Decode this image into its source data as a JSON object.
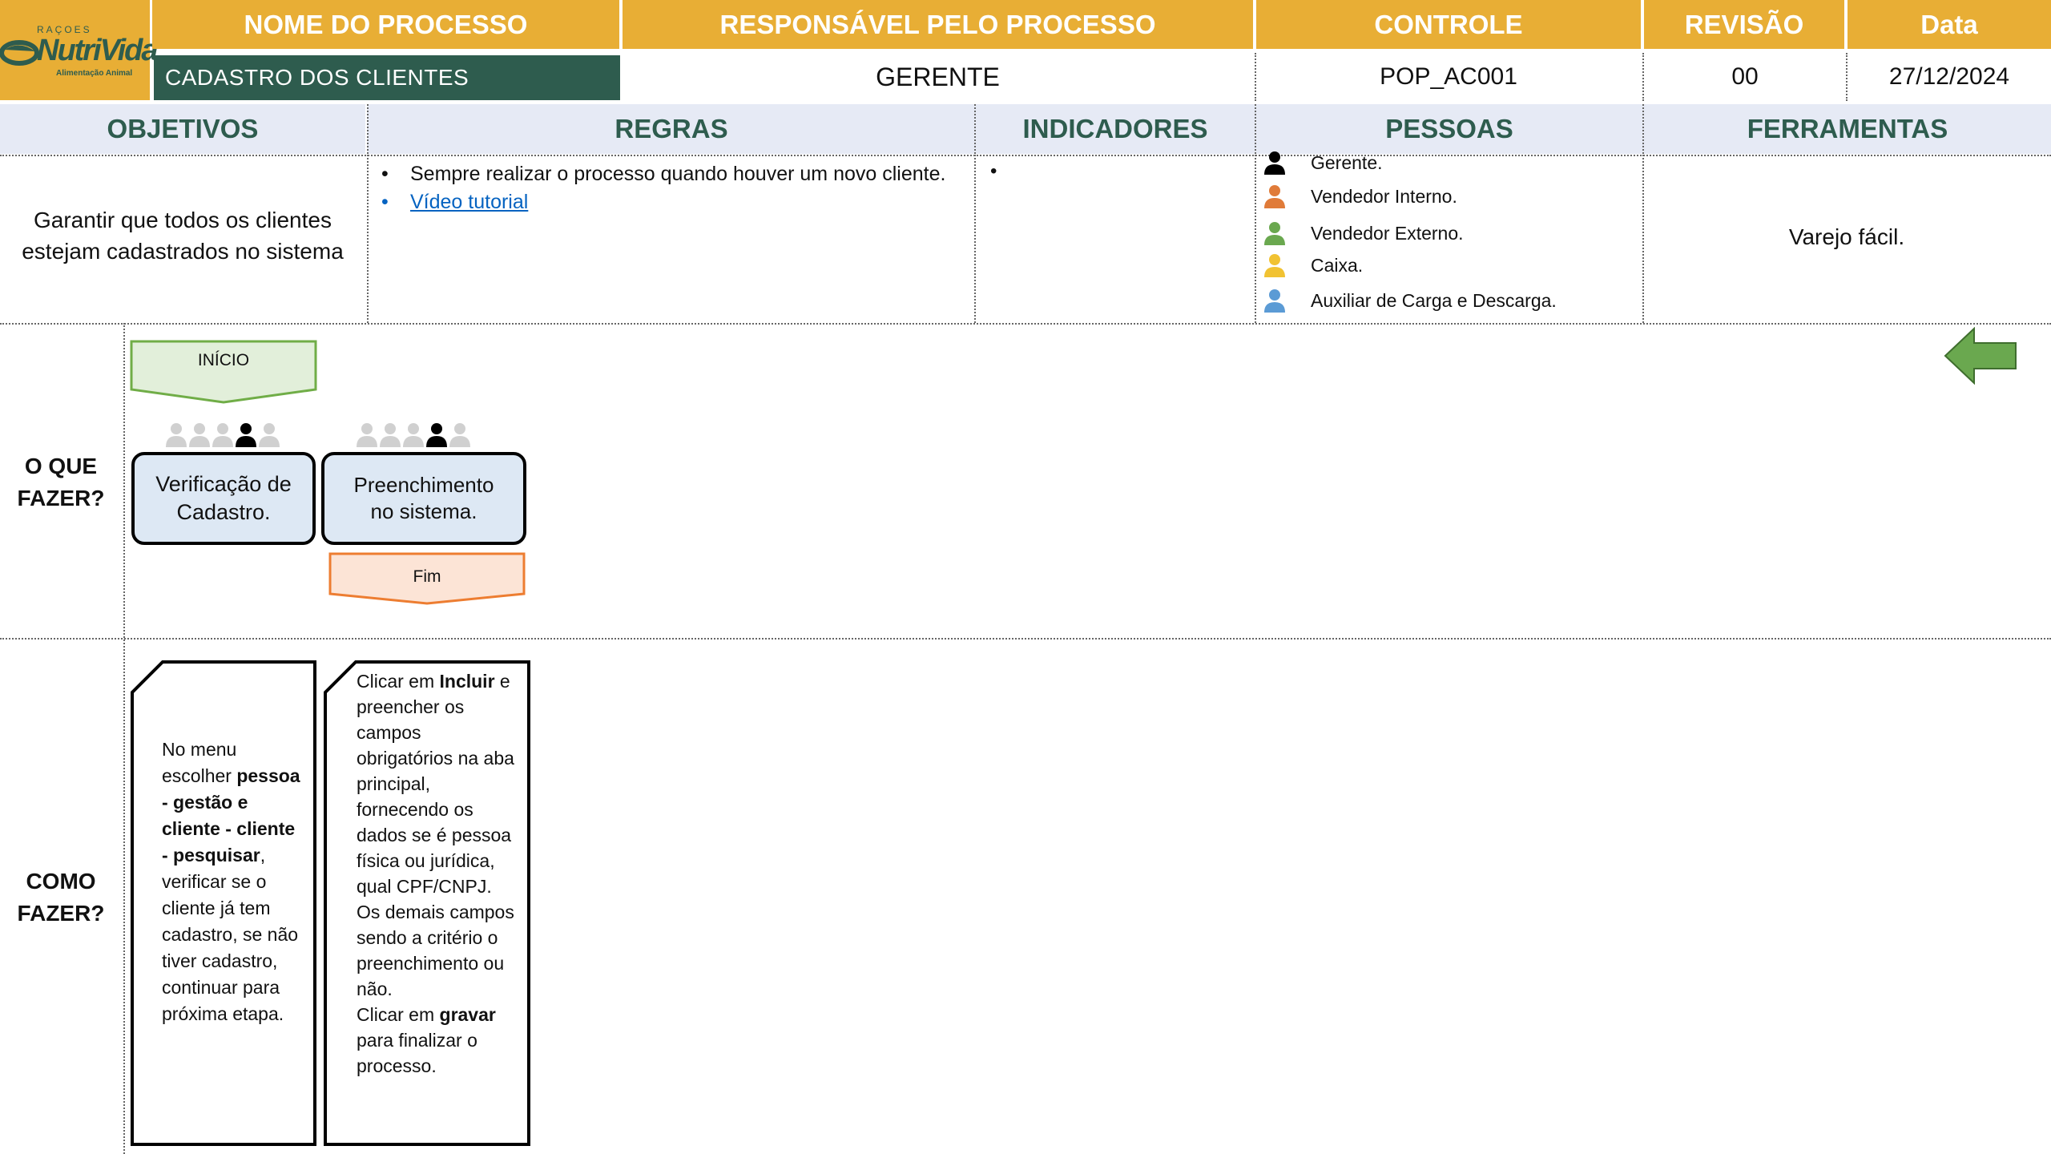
{
  "logo": {
    "top": "RAÇOES",
    "brand": "NutriVida",
    "sub": "Alimentação Animal"
  },
  "header": {
    "nome_label": "NOME DO PROCESSO",
    "responsavel_label": "RESPONSÁVEL PELO PROCESSO",
    "controle_label": "CONTROLE",
    "revisao_label": "REVISÃO",
    "data_label": "Data",
    "nome_value": "CADASTRO DOS CLIENTES",
    "responsavel_value": "GERENTE",
    "controle_value": "POP_AC001",
    "revisao_value": "00",
    "data_value": "27/12/2024"
  },
  "sections": {
    "objetivos": "OBJETIVOS",
    "regras": "REGRAS",
    "indicadores": "INDICADORES",
    "pessoas": "PESSOAS",
    "ferramentas": "FERRAMENTAS"
  },
  "objetivos_text": "Garantir que todos os clientes estejam cadastrados no sistema",
  "regras": {
    "rule1": "Sempre realizar o processo quando houver um novo cliente.",
    "link": "Vídeo tutorial"
  },
  "indicadores": {
    "bullet": ""
  },
  "pessoas": [
    {
      "label": "Gerente.",
      "color": "#000000"
    },
    {
      "label": "Vendedor Interno.",
      "color": "#E07B39"
    },
    {
      "label": "Vendedor Externo.",
      "color": "#6AA84F"
    },
    {
      "label": "Caixa.",
      "color": "#F1C232"
    },
    {
      "label": "Auxiliar de Carga e Descarga.",
      "color": "#5B9BD5"
    }
  ],
  "ferramentas_text": "Varejo fácil.",
  "o_que_fazer": {
    "label_line1": "O QUE",
    "label_line2": "FAZER?",
    "inicio": "INÍCIO",
    "fim": "Fim",
    "steps": [
      {
        "text_line1": "Verificação de",
        "text_line2": "Cadastro.",
        "active_person": 3
      },
      {
        "text_line1": "Preenchimento",
        "text_line2": "no sistema.",
        "active_person": 3
      }
    ]
  },
  "como_fazer": {
    "label_line1": "COMO",
    "label_line2": "FAZER?",
    "card1": {
      "a": "No menu escolher ",
      "b": "pessoa - gestão e cliente - cliente - pesquisar",
      "c": ", verificar se o cliente já tem cadastro, se não tiver cadastro, continuar para próxima etapa."
    },
    "card2": {
      "a": "Clicar em ",
      "b": "Incluir",
      "c": " e preencher os campos obrigatórios na aba principal, fornecendo os dados se é pessoa física ou jurídica, qual CPF/CNPJ.",
      "d": "Os demais campos sendo a critério o preenchimento ou não.",
      "e": "Clicar em ",
      "f": "gravar",
      "g": " para finalizar o processo."
    }
  },
  "colors": {
    "header_bg": "#E8AE35",
    "process_name_bg": "#2E5C4E",
    "section_bg": "#E6EAF5",
    "section_text": "#2E5C4E",
    "step_bg": "#DDE8F4",
    "inicio_bg": "#E2EFDA",
    "inicio_border": "#70AD47",
    "fim_bg": "#FCE4D6",
    "fim_border": "#ED7D31",
    "back_arrow": "#6AA84F",
    "link": "#0563C1"
  }
}
